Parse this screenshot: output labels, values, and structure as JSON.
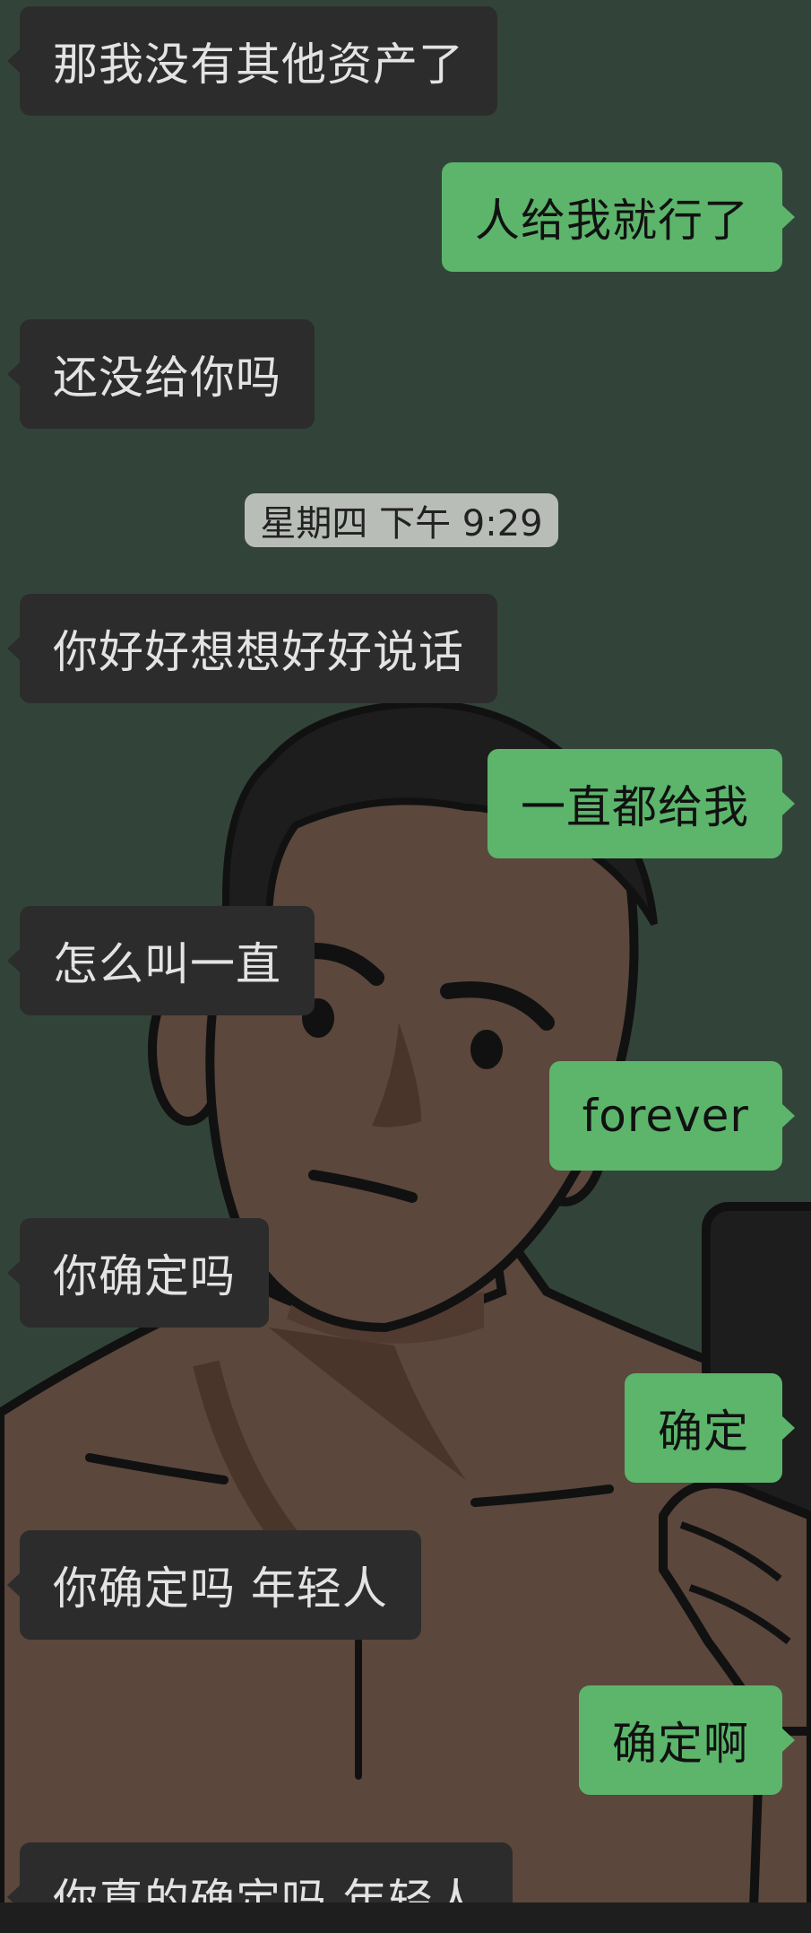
{
  "chat": {
    "timestamp": "星期四 下午 9:29",
    "messages": [
      {
        "side": "in",
        "text": "那我没有其他资产了"
      },
      {
        "side": "out",
        "text": "人给我就行了"
      },
      {
        "side": "in",
        "text": "还没给你吗"
      },
      {
        "side": "in",
        "text": "你好好想想好好说话"
      },
      {
        "side": "out",
        "text": "一直都给我"
      },
      {
        "side": "in",
        "text": "怎么叫一直"
      },
      {
        "side": "out",
        "text": "forever"
      },
      {
        "side": "in",
        "text": "你确定吗"
      },
      {
        "side": "out",
        "text": "确定"
      },
      {
        "side": "in",
        "text": "你确定吗 年轻人"
      },
      {
        "side": "out",
        "text": "确定啊"
      },
      {
        "side": "in",
        "text": "你真的确定吗 年轻人"
      }
    ]
  },
  "colors": {
    "background": "#324439",
    "incoming_bubble": "#2c2c2c",
    "outgoing_bubble": "#5cb56b",
    "timestamp_bg": "#b9bdb8"
  },
  "icons": {
    "background": "cartoon-man-selfie-illustration"
  }
}
